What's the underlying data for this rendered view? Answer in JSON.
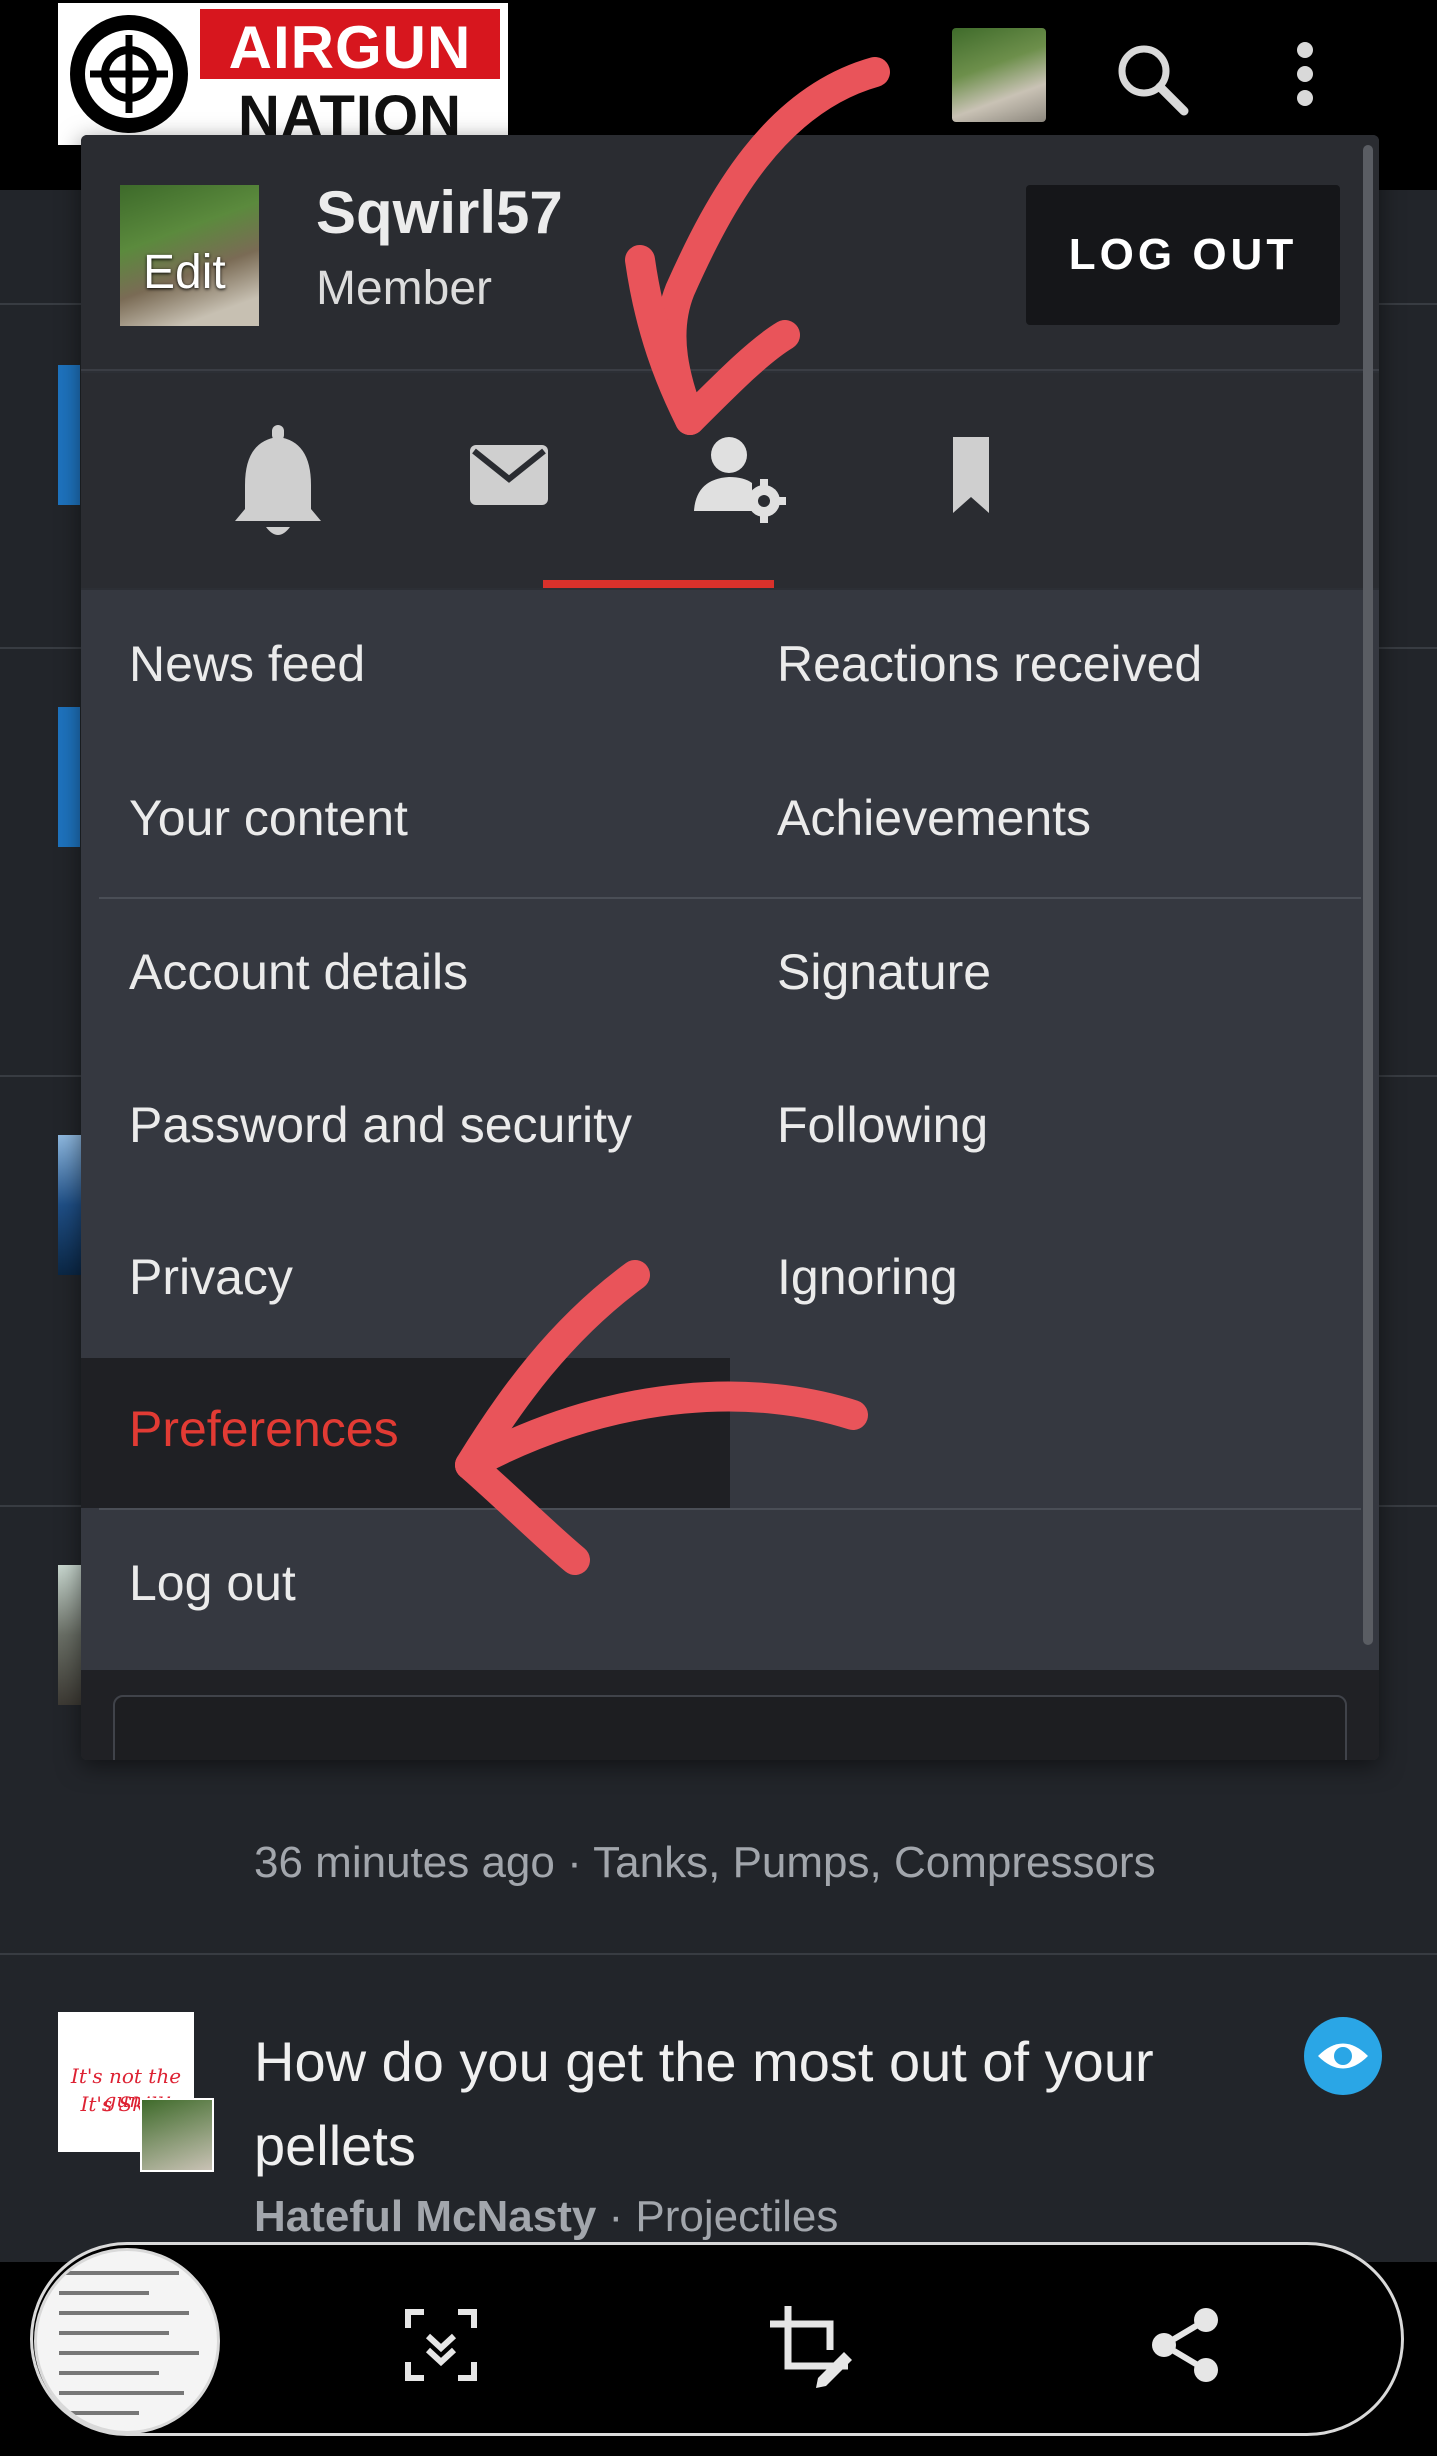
{
  "brand": {
    "logo_top": "AIRGUN",
    "logo_bottom": "NATION",
    "red": "#d7161e"
  },
  "header": {
    "icons": [
      "avatar",
      "search-icon",
      "more-vertical-icon"
    ]
  },
  "user_menu": {
    "username": "Sqwirl57",
    "role": "Member",
    "avatar_edit_label": "Edit",
    "logout_button_label": "LOG OUT",
    "tabs": [
      {
        "icon": "bell-icon",
        "active": false
      },
      {
        "icon": "envelope-icon",
        "active": false
      },
      {
        "icon": "user-cog-icon",
        "active": true
      },
      {
        "icon": "bookmark-icon",
        "active": false
      }
    ],
    "items": {
      "news_feed": "News feed",
      "reactions_received": "Reactions received",
      "your_content": "Your content",
      "achievements": "Achievements",
      "account_details": "Account details",
      "signature": "Signature",
      "password_security": "Password and security",
      "following": "Following",
      "privacy": "Privacy",
      "ignoring": "Ignoring",
      "preferences": "Preferences",
      "log_out": "Log out"
    },
    "active_item": "Preferences",
    "accent_color": "#d8312b"
  },
  "feed": {
    "meta": "36 minutes ago · Tanks, Pumps, Compressors",
    "thread_title": "How do you get the most out of your pellets",
    "thread_author": "Hateful McNasty",
    "thread_forum": "· Projectiles",
    "avatar_caption_1": "It's not the gun,",
    "avatar_caption_2": "It's Skill!"
  },
  "bottom_toolbar": {
    "icons": [
      "screenshot-preview",
      "scroll-capture-icon",
      "crop-edit-icon",
      "share-icon"
    ]
  },
  "annotation": {
    "arrow_color": "#e9545a"
  }
}
